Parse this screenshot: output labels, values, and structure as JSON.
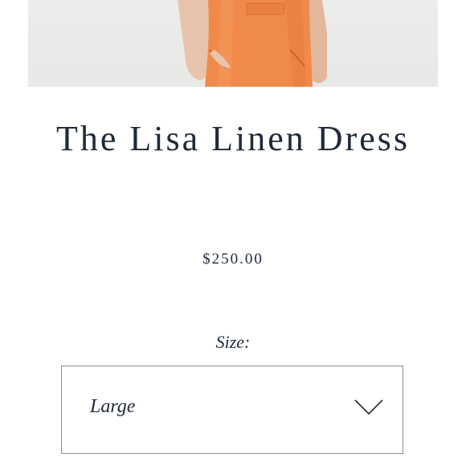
{
  "product": {
    "image_icon": "orange-linen-dress-photo",
    "title": "The Lisa Linen Dress",
    "price": "$250.00"
  },
  "size": {
    "label": "Size:",
    "selected": "Large",
    "dropdown_icon": "chevron-down-icon"
  },
  "colors": {
    "text": "#1f2a38",
    "dress": "#f08a4b",
    "border": "#8a8f96"
  }
}
